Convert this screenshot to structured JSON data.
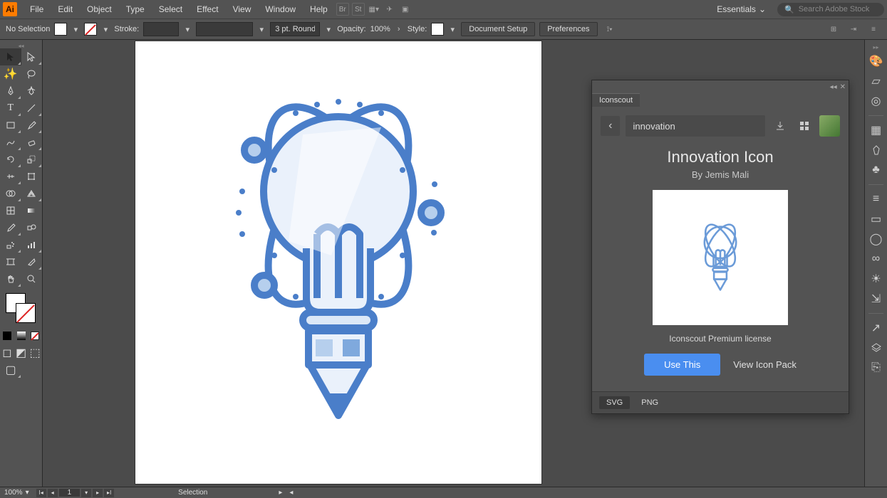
{
  "menubar": {
    "items": [
      "File",
      "Edit",
      "Object",
      "Type",
      "Select",
      "Effect",
      "View",
      "Window",
      "Help"
    ],
    "workspace": "Essentials",
    "search_placeholder": "Search Adobe Stock"
  },
  "optionsbar": {
    "selection": "No Selection",
    "stroke_label": "Stroke:",
    "stroke_weight": "",
    "stroke_profile": "3 pt. Round",
    "opacity_label": "Opacity:",
    "opacity_value": "100%",
    "style_label": "Style:",
    "buttons": [
      "Document Setup",
      "Preferences"
    ]
  },
  "statusbar": {
    "zoom": "100%",
    "artboard_num": "1",
    "tool": "Selection"
  },
  "panel": {
    "tab": "Iconscout",
    "search_value": "innovation",
    "title": "Innovation Icon",
    "by_prefix": "By",
    "author": "Jemis Mali",
    "license": "Iconscout Premium license",
    "use_btn": "Use This",
    "pack_btn": "View Icon Pack",
    "formats": [
      "SVG",
      "PNG"
    ],
    "active_format": "SVG"
  },
  "tools": {
    "left_col": [
      "selection",
      "magic-wand",
      "pen",
      "type",
      "line",
      "paintbrush",
      "shape-builder",
      "rotate",
      "mesh",
      "width",
      "eyedropper",
      "chart",
      "artboard",
      "hand"
    ],
    "right_col": [
      "direct-selection",
      "lasso",
      "curvature",
      "touch-type",
      "rectangle",
      "blob-brush",
      "gradient",
      "scale",
      "free-transform",
      "eraser",
      "paint-bucket",
      "symbol-sprayer",
      "slice",
      "zoom"
    ]
  },
  "rail_icons": [
    "palette",
    "file",
    "target-icon",
    "library",
    "shirt",
    "club",
    "menu-lines",
    "window",
    "sphere",
    "cc",
    "sun",
    "swap",
    "forward",
    "layers",
    "new-file"
  ]
}
